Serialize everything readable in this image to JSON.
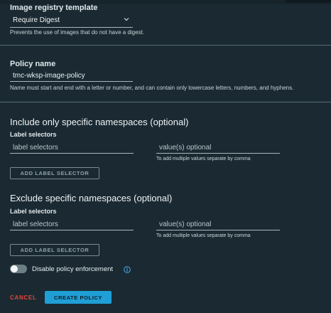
{
  "image_registry": {
    "label": "Image registry template",
    "selected": "Require Digest",
    "helper": "Prevents the use of images that do not have a digest."
  },
  "policy_name": {
    "label": "Policy name",
    "value": "tmc-wksp-image-policy",
    "helper": "Name must start and end with a letter or number, and can contain only lowercase letters, numbers, and hyphens."
  },
  "include": {
    "heading": "Include only specific namespaces (optional)",
    "selectors_label": "Label selectors",
    "selector_placeholder": "label selectors",
    "value_placeholder": "value(s) optional",
    "value_helper": "To add multiple values separate by comma",
    "add_button": "ADD LABEL SELECTOR"
  },
  "exclude": {
    "heading": "Exclude specific namespaces (optional)",
    "selectors_label": "Label selectors",
    "selector_placeholder": "label selectors",
    "value_placeholder": "value(s) optional",
    "value_helper": "To add multiple values separate by comma",
    "add_button": "ADD LABEL SELECTOR"
  },
  "enforcement": {
    "label": "Disable policy enforcement",
    "enabled": false
  },
  "actions": {
    "cancel": "CANCEL",
    "create": "CREATE POLICY"
  },
  "colors": {
    "background": "#1b2a32",
    "primary": "#1f9fd6",
    "danger": "#e0463c",
    "info": "#49a9e6"
  },
  "icons": {
    "select_chevron": "chevron-down-icon",
    "info": "info-icon"
  }
}
